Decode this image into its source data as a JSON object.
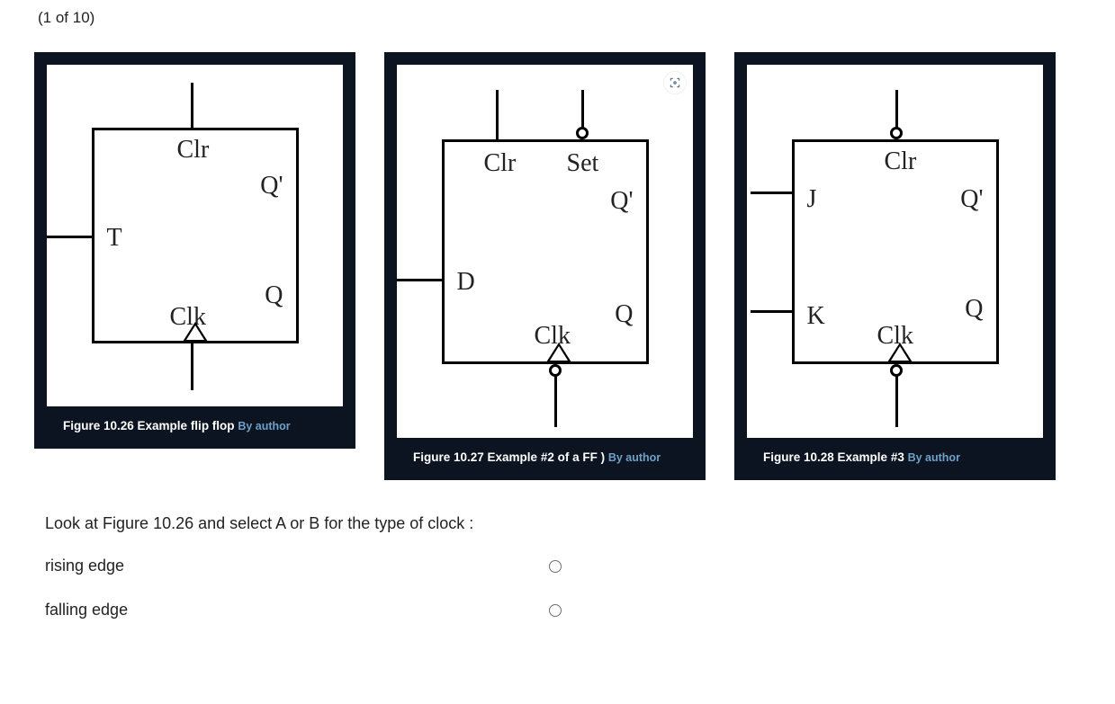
{
  "counter": "(1 of 10)",
  "figures": [
    {
      "caption_title": "Figure 10.26 Example flip flop ",
      "caption_attrib": "By author",
      "labels": {
        "top1": "Clr",
        "left1": "T",
        "clk": "Clk",
        "q": "Q",
        "qn": "Q'"
      }
    },
    {
      "caption_title": "Figure 10.27 Example #2 of a FF ) ",
      "caption_attrib": "By author",
      "labels": {
        "top1": "Clr",
        "top2": "Set",
        "left1": "D",
        "clk": "Clk",
        "q": "Q",
        "qn": "Q'"
      }
    },
    {
      "caption_title": "Figure 10.28 Example #3 ",
      "caption_attrib": "By author",
      "labels": {
        "top1": "Clr",
        "left1": "J",
        "left2": "K",
        "clk": "Clk",
        "q": "Q",
        "qn": "Q'"
      }
    }
  ],
  "question": {
    "prompt": "Look at Figure 10.26 and select A or B for the type of clock :",
    "options": [
      {
        "label": "rising edge",
        "selected": false
      },
      {
        "label": "falling edge",
        "selected": false
      }
    ]
  }
}
